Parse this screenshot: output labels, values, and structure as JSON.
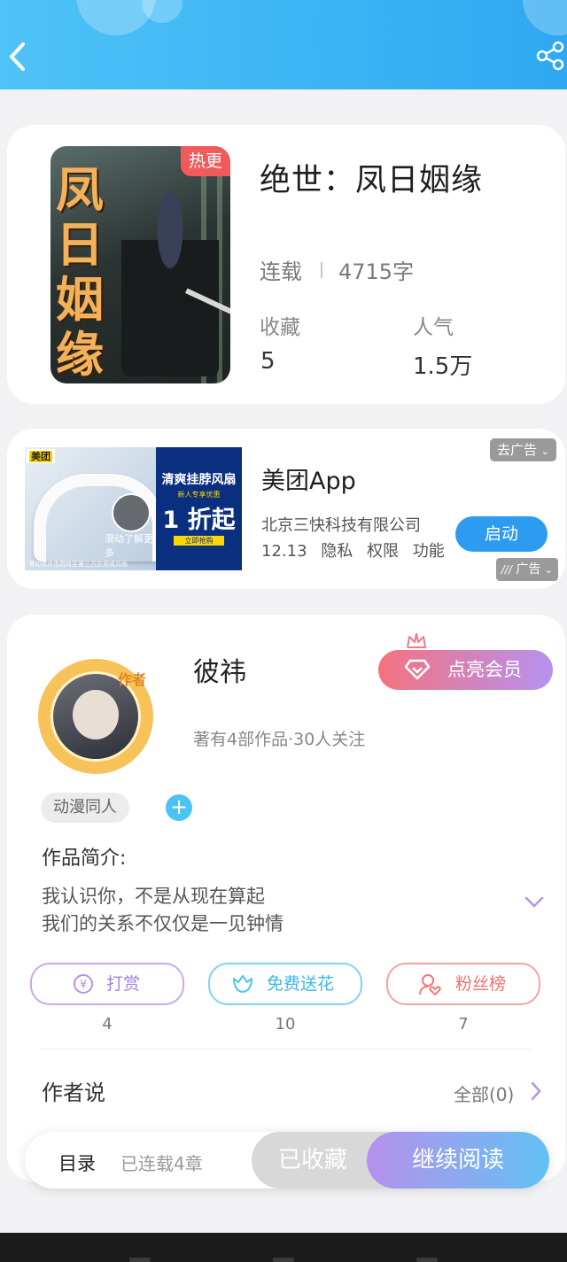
{
  "book": {
    "title": "绝世：凤日姻缘",
    "badge": "热更",
    "cover_text": "凤日姻缘",
    "status": "连载",
    "word_count": "4715字",
    "favorites_label": "收藏",
    "favorites_value": "5",
    "popularity_label": "人气",
    "popularity_value": "1.5万"
  },
  "ad": {
    "app_name": "美团App",
    "company": "北京三快科技有限公司",
    "version": "12.13",
    "links": [
      "隐私",
      "权限",
      "功能"
    ],
    "close_label": "去广告",
    "launch_label": "启动",
    "ad_tag": "广告",
    "image_brand": "美团",
    "image_headline": "清爽挂脖风扇",
    "image_sub": "新人专享优惠",
    "image_discount": "1 折起",
    "image_cta": "立即抢购",
    "image_play_label": "滑动了解更多",
    "image_caption": "滑动或点击跳转至第三方应用或页面"
  },
  "author": {
    "name": "彼祎",
    "avatar_tag": "作者",
    "meta": "著有4部作品·30人关注",
    "vip_label": "点亮会员",
    "tag": "动漫同人",
    "add_tag": "+",
    "intro_label": "作品简介:",
    "intro_lines": [
      "我认识你，不是从现在算起",
      "我们的关系不仅仅是一见钟情"
    ]
  },
  "actions": [
    {
      "label": "打赏",
      "count": "4"
    },
    {
      "label": "免费送花",
      "count": "10"
    },
    {
      "label": "粉丝榜",
      "count": "7"
    }
  ],
  "author_says": {
    "label": "作者说",
    "all_label": "全部(0)"
  },
  "bottom_bar": {
    "toc_label": "目录",
    "chapters": "已连载4章",
    "collected_label": "已收藏",
    "read_label": "继续阅读"
  },
  "colors": {
    "header": "#2ea8f2",
    "hot_badge": "#f05a5a",
    "reward": "#b591ec",
    "flower": "#4cc3f3",
    "fans": "#f07a7a",
    "launch": "#2d9cf0"
  }
}
